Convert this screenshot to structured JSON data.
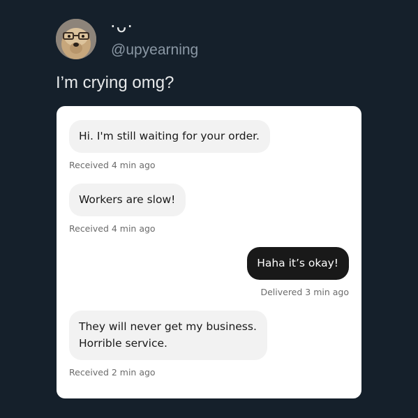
{
  "post": {
    "display_name": "·ᴗ·",
    "handle": "@upyearning",
    "text": "I’m crying omg?"
  },
  "colors": {
    "background": "#15202b",
    "card": "#ffffff",
    "incoming_bubble": "#f2f2f2",
    "outgoing_bubble": "#191919"
  },
  "messages": [
    {
      "direction": "incoming",
      "lines": [
        "Hi. I'm still waiting for your order."
      ],
      "status": "Received 4 min ago"
    },
    {
      "direction": "incoming",
      "lines": [
        "Workers are slow!"
      ],
      "status": "Received 4 min ago"
    },
    {
      "direction": "outgoing",
      "lines": [
        "Haha it’s okay!"
      ],
      "status": "Delivered 3 min ago"
    },
    {
      "direction": "incoming",
      "lines": [
        "They will never get my business.",
        "Horrible service."
      ],
      "status": "Received 2 min ago"
    }
  ]
}
